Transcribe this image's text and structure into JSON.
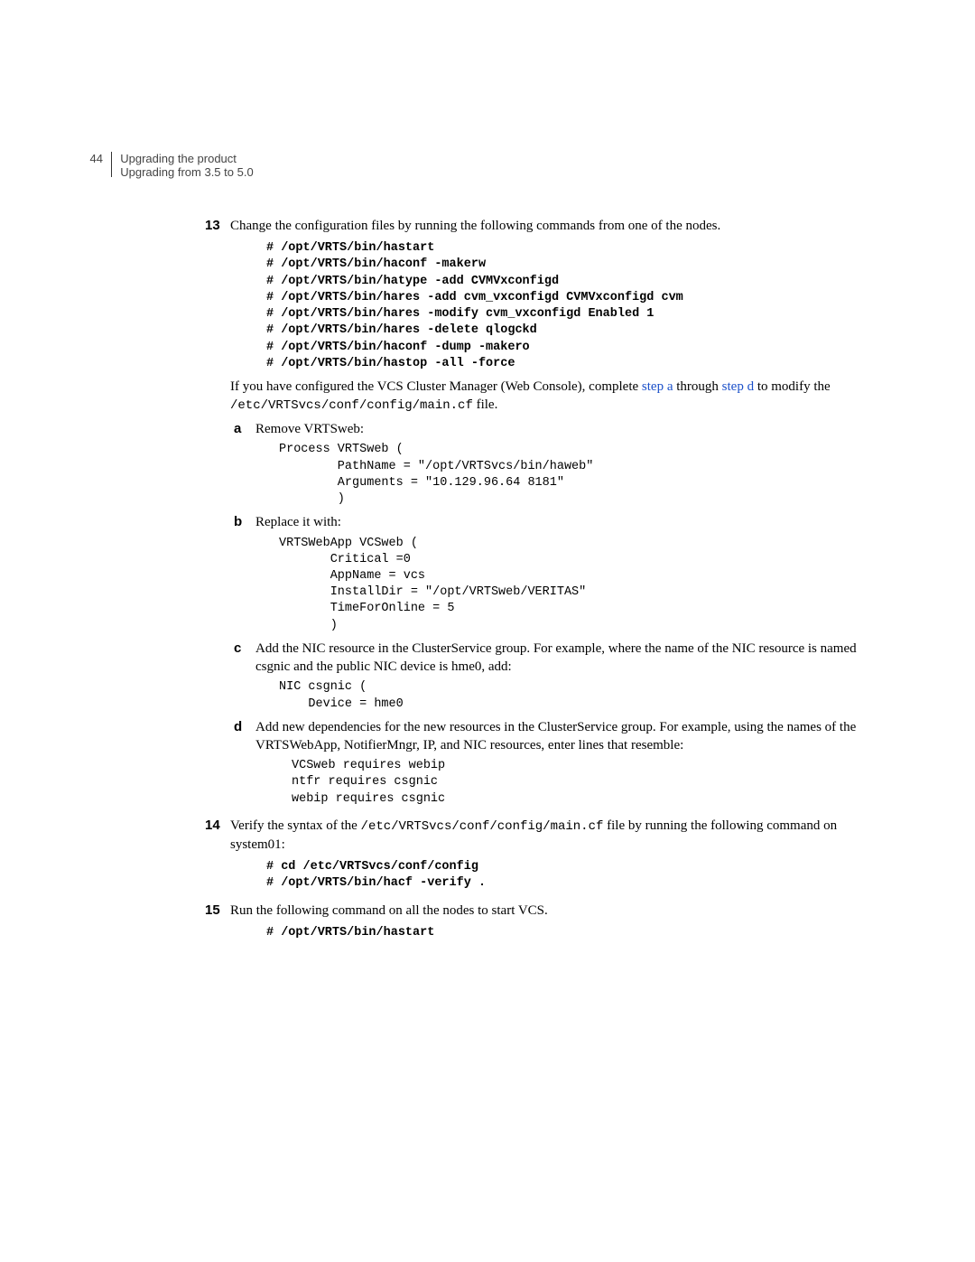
{
  "header": {
    "page_num": "44",
    "chapter": "Upgrading the product",
    "section": "Upgrading from 3.5 to 5.0"
  },
  "steps": {
    "s13_num": "13",
    "s13_text": "Change the configuration files by running the following commands from one of the nodes.",
    "s13_code": "# /opt/VRTS/bin/hastart\n# /opt/VRTS/bin/haconf -makerw\n# /opt/VRTS/bin/hatype -add CVMVxconfigd\n# /opt/VRTS/bin/hares -add cvm_vxconfigd CVMVxconfigd cvm\n# /opt/VRTS/bin/hares -modify cvm_vxconfigd Enabled 1\n# /opt/VRTS/bin/hares -delete qlogckd\n# /opt/VRTS/bin/haconf -dump -makero\n# /opt/VRTS/bin/hastop -all -force",
    "s13_aftertext_1": "If you have configured the VCS Cluster Manager (Web Console), complete ",
    "s13_link_a": "step a",
    "s13_mid": " through ",
    "s13_link_d": "step d",
    "s13_after_2": " to modify the ",
    "s13_cfgfile": "/etc/VRTSvcs/conf/config/main.cf",
    "s13_after_3": " file.",
    "sa_label": "a",
    "sa_text": "Remove VRTSweb:",
    "sa_code": "Process VRTSweb (\n        PathName = \"/opt/VRTSvcs/bin/haweb\"\n        Arguments = \"10.129.96.64 8181\"\n        )",
    "sb_label": "b",
    "sb_text": "Replace it with:",
    "sb_code": "VRTSWebApp VCSweb (\n       Critical =0\n       AppName = vcs\n       InstallDir = \"/opt/VRTSweb/VERITAS\"\n       TimeForOnline = 5\n       )",
    "sc_label": "c",
    "sc_text": "Add the NIC resource in the ClusterService group. For example, where the name of the NIC resource is named csgnic and the public NIC device is hme0, add:",
    "sc_code": "NIC csgnic (\n    Device = hme0",
    "sd_label": "d",
    "sd_text": "Add new dependencies for the new resources in the ClusterService group. For example, using the names of the VRTSWebApp, NotifierMngr, IP, and NIC resources, enter lines that resemble:",
    "sd_code": "VCSweb requires webip\nntfr requires csgnic\nwebip requires csgnic",
    "s14_num": "14",
    "s14_text_1": "Verify the syntax of the ",
    "s14_file": "/etc/VRTSvcs/conf/config/main.cf",
    "s14_text_2": " file by running the following command on system01:",
    "s14_code": "# cd /etc/VRTSvcs/conf/config\n# /opt/VRTS/bin/hacf -verify .",
    "s15_num": "15",
    "s15_text": "Run the following command on all the nodes to start VCS.",
    "s15_code": "# /opt/VRTS/bin/hastart"
  }
}
